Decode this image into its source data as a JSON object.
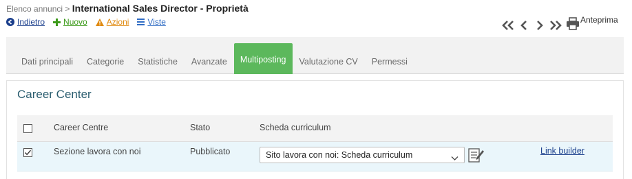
{
  "breadcrumb": {
    "parent": "Elenco annunci",
    "separator": ">",
    "title": "International Sales Director - Proprietà"
  },
  "actions": [
    {
      "label": "Indietro",
      "icon": "arrow-left-circle-icon"
    },
    {
      "label": "Nuovo",
      "icon": "plus-icon"
    },
    {
      "label": "Azioni",
      "icon": "warning-icon"
    },
    {
      "label": "Viste",
      "icon": "list-icon"
    }
  ],
  "pager": {
    "preview_label": "Anteprima"
  },
  "tabs": [
    {
      "label": "Dati principali",
      "active": false
    },
    {
      "label": "Categorie",
      "active": false
    },
    {
      "label": "Statistiche",
      "active": false
    },
    {
      "label": "Avanzate",
      "active": false
    },
    {
      "label": "Multiposting",
      "active": true
    },
    {
      "label": "Valutazione CV",
      "active": false
    },
    {
      "label": "Permessi",
      "active": false
    }
  ],
  "panel": {
    "title": "Career Center",
    "columns": {
      "career_centre": "Career Centre",
      "stato": "Stato",
      "scheda": "Scheda curriculum"
    },
    "rows": [
      {
        "checked": true,
        "career_centre": "Sezione lavora con noi",
        "stato": "Pubblicato",
        "scheda_selected": "Sito lavora con noi: Scheda curriculum",
        "link_label": "Link builder"
      }
    ]
  },
  "colors": {
    "accent_green": "#5cb85c",
    "link_blue": "#1b3f8c",
    "new_green": "#3c9a1a",
    "actions_orange": "#e08a10",
    "title_teal": "#2a5d6f"
  }
}
